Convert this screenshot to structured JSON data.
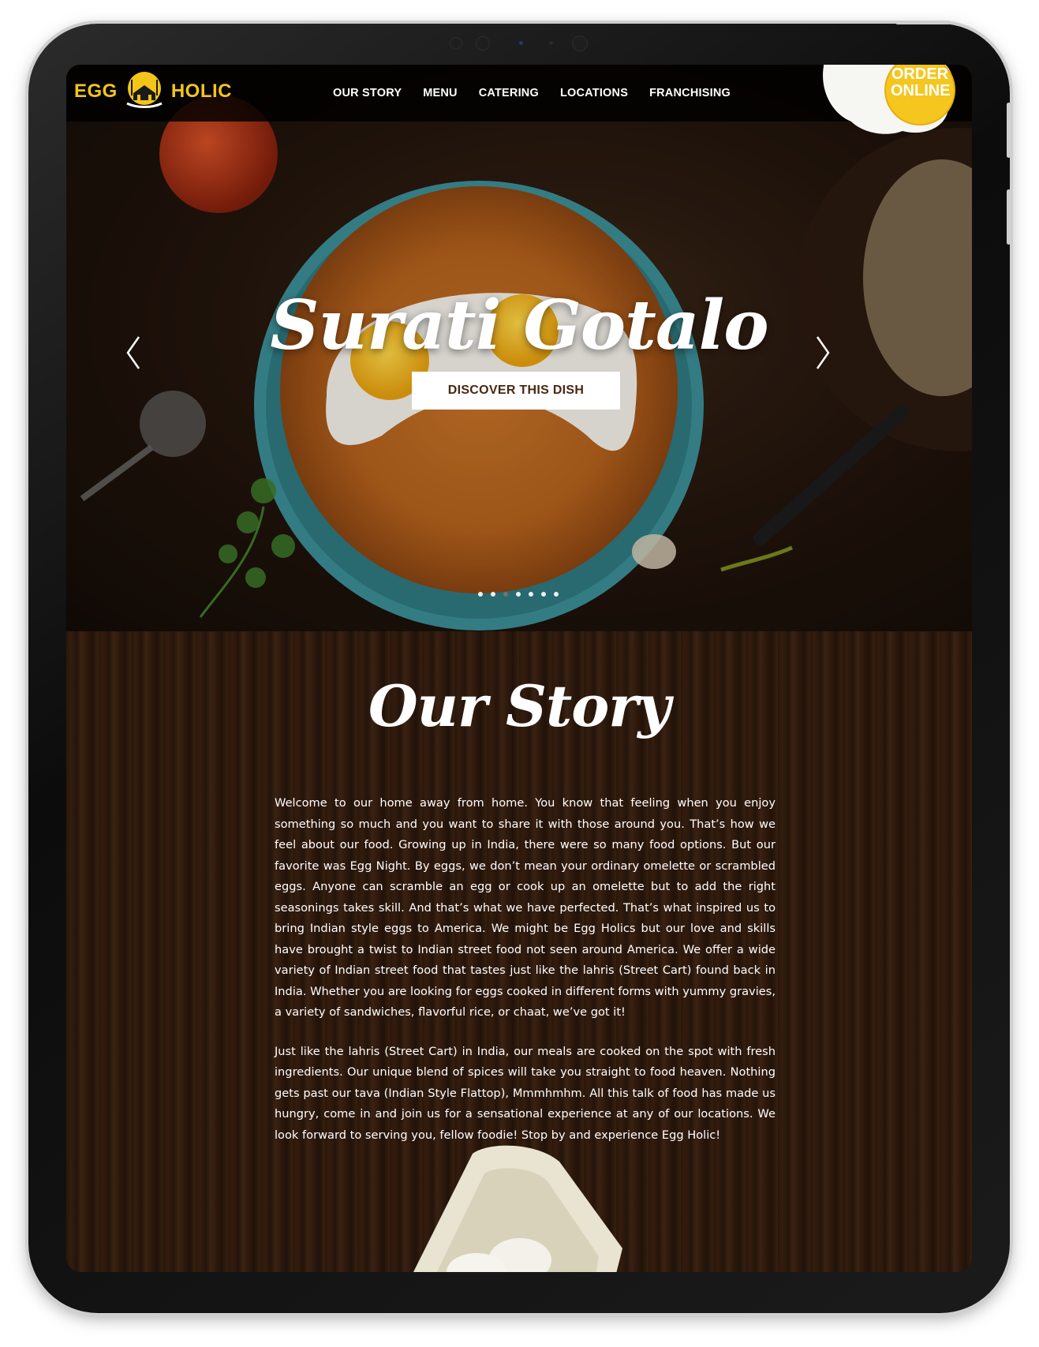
{
  "brand": {
    "left_word": "EGG",
    "right_word": "HOLIC"
  },
  "nav": {
    "items": [
      "OUR STORY",
      "MENU",
      "CATERING",
      "LOCATIONS",
      "FRANCHISING"
    ]
  },
  "order": {
    "line1": "ORDER",
    "line2": "ONLINE"
  },
  "hero": {
    "title": "Surati Gotalo",
    "cta": "DISCOVER THIS DISH",
    "slide_count": 7,
    "active_slide": 3
  },
  "story": {
    "title": "Our Story",
    "paragraphs": [
      "Welcome to our home away from home. You know that feeling when you enjoy something so much and you want to share it with those around you. That’s how we feel about our food. Growing up in India, there were so many food options. But our favorite was Egg Night. By eggs, we don’t mean your ordinary omelette or scrambled eggs. Anyone can scramble an egg or cook up an omelette but to add the right seasonings takes skill. And that’s what we have perfected.  That’s what inspired us to bring Indian style eggs to America. We might be Egg Holics but our love and skills have brought a twist to Indian street food not seen around America. We offer a wide variety of Indian street food that tastes just like the lahris (Street Cart) found back in India. Whether you are looking for eggs cooked in different forms with yummy gravies, a variety of sandwiches, flavorful rice, or chaat, we’ve got it!",
      "Just like the lahris (Street Cart) in India, our meals are cooked on the spot with fresh ingredients. Our unique blend of spices will take you straight to food heaven. Nothing gets past our tava (Indian Style Flattop), Mmmhmhm. All this talk of food has made us hungry, come in and join us for a sensational experience at any of our locations. We look forward to serving you, fellow foodie! Stop by and experience Egg Holic!"
    ]
  },
  "colors": {
    "brand_yellow": "#f3c518",
    "cta_text": "#4a2612",
    "header_bg": "#000000"
  }
}
